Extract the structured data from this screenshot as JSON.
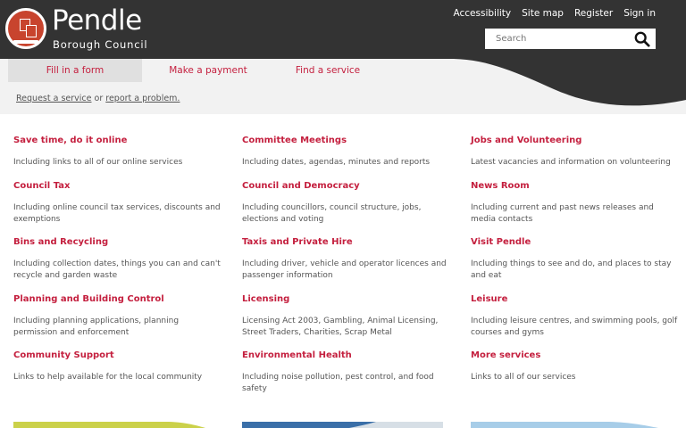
{
  "header": {
    "logo_title": "Pendle",
    "logo_subtitle": "Borough Council",
    "links": [
      "Accessibility",
      "Site map",
      "Register",
      "Sign in"
    ],
    "search_placeholder": "Search"
  },
  "tabs": [
    "Fill in a form",
    "Make a payment",
    "Find a service"
  ],
  "request_line": {
    "link1": "Request a service",
    "middle": " or ",
    "link2": "report a problem."
  },
  "columns": [
    [
      {
        "title": "Save time, do it online",
        "desc": "Including links to all of our online services"
      },
      {
        "title": "Council Tax",
        "desc": "Including online council tax services, discounts and exemptions"
      },
      {
        "title": "Bins and Recycling",
        "desc": "Including collection dates, things you can and can't recycle and garden waste"
      },
      {
        "title": "Planning and Building Control",
        "desc": "Including planning applications, planning permission and enforcement"
      },
      {
        "title": "Community Support",
        "desc": "Links to help available for the local community"
      }
    ],
    [
      {
        "title": "Committee Meetings",
        "desc": "Including dates, agendas, minutes and reports"
      },
      {
        "title": "Council and Democracy",
        "desc": "Including councillors, council structure, jobs, elections and voting"
      },
      {
        "title": "Taxis and Private Hire",
        "desc": "Including driver, vehicle and operator licences and passenger information"
      },
      {
        "title": "Licensing",
        "desc": "Licensing Act 2003, Gambling, Animal Licensing, Street Traders, Charities, Scrap Metal"
      },
      {
        "title": "Environmental Health",
        "desc": "Including noise pollution, pest control, and food safety"
      }
    ],
    [
      {
        "title": "Jobs and Volunteering",
        "desc": "Latest vacancies and information on volunteering"
      },
      {
        "title": "News Room",
        "desc": "Including current and past news releases and media contacts"
      },
      {
        "title": "Visit Pendle",
        "desc": "Including things to see and do, and places to stay and eat"
      },
      {
        "title": "Leisure",
        "desc": "Including leisure centres, and swimming pools, golf courses and gyms"
      },
      {
        "title": "More services",
        "desc": "Links to all of our services"
      }
    ]
  ],
  "colors": {
    "accent": "#c41f3e",
    "header_bg": "#333333",
    "logo_red": "#c8442e"
  }
}
